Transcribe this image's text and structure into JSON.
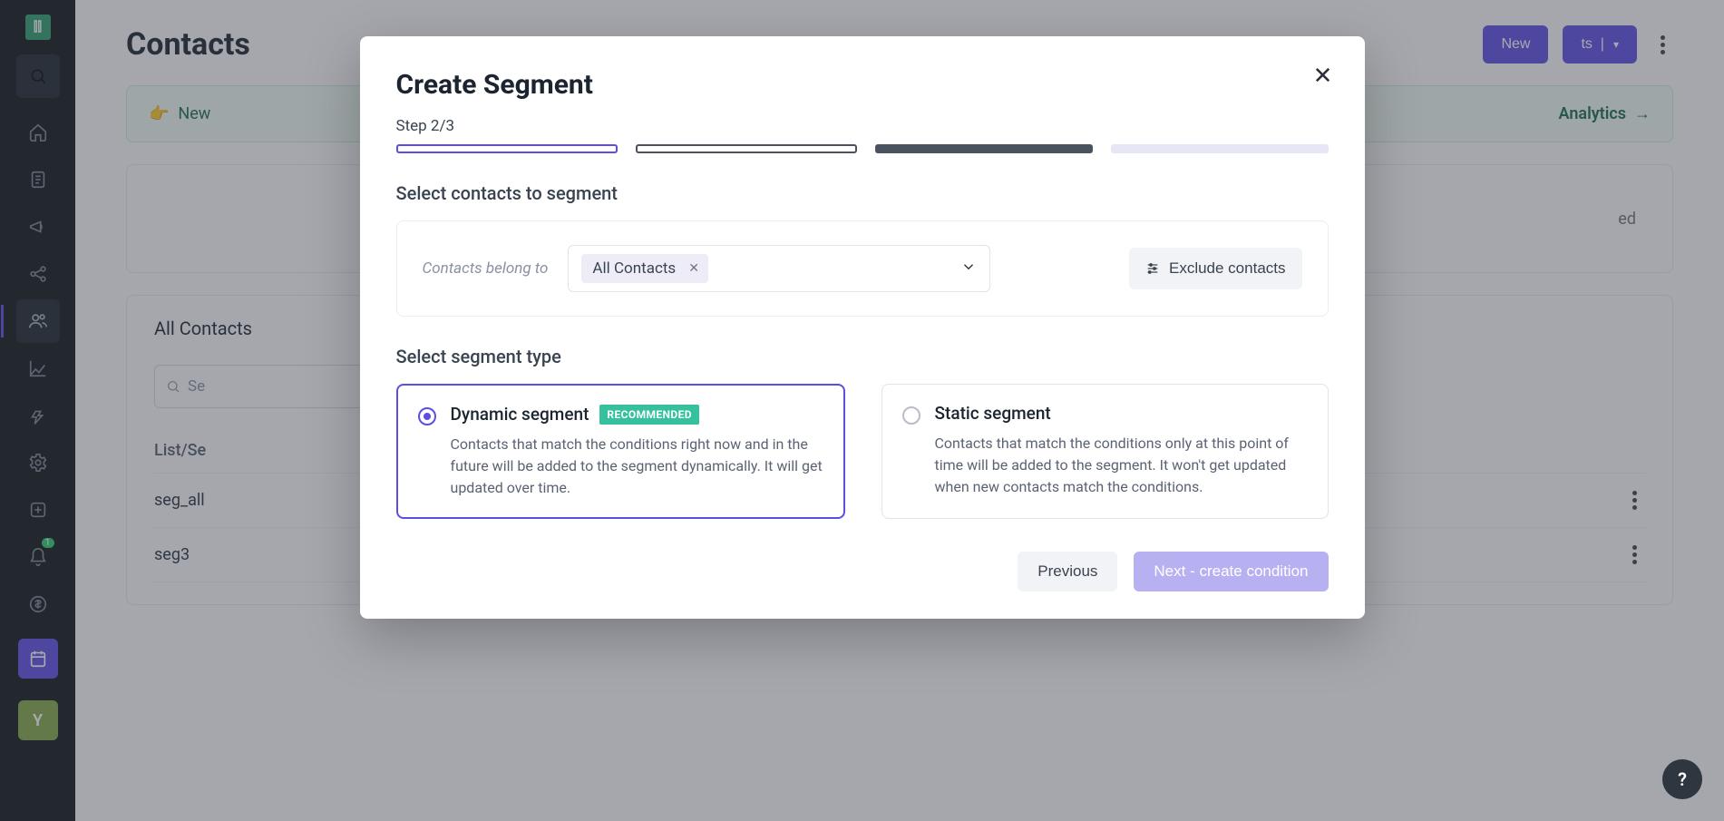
{
  "sidebar": {
    "logo_glyph": "⫿⫿",
    "avatar_letter": "Y",
    "bell_badge": "1"
  },
  "page": {
    "title": "Contacts",
    "button1": "New",
    "button2_label": "Segments",
    "button2_suffix": "|",
    "banner_left": "New",
    "banner_right_label": "Analytics",
    "empty_text": "updated",
    "tab": "All Contacts",
    "search_placeholder": "Search",
    "th": "List/Segment",
    "rows": [
      "seg_all",
      "seg3"
    ]
  },
  "modal": {
    "title": "Create Segment",
    "step_label": "Step 2/3",
    "section_contacts": "Select contacts to segment",
    "contacts_belong": "Contacts belong to",
    "chip": "All Contacts",
    "exclude": "Exclude contacts",
    "section_type": "Select segment type",
    "dynamic": {
      "title": "Dynamic segment",
      "badge": "RECOMMENDED",
      "desc": "Contacts that match the conditions right now and in the future will be added to the segment dynamically. It will get updated over time."
    },
    "static": {
      "title": "Static segment",
      "desc": "Contacts that match the conditions only at this point of time will be added to the segment. It won't get updated when new contacts match the conditions."
    },
    "prev": "Previous",
    "next": "Next - create condition"
  },
  "help": "?"
}
